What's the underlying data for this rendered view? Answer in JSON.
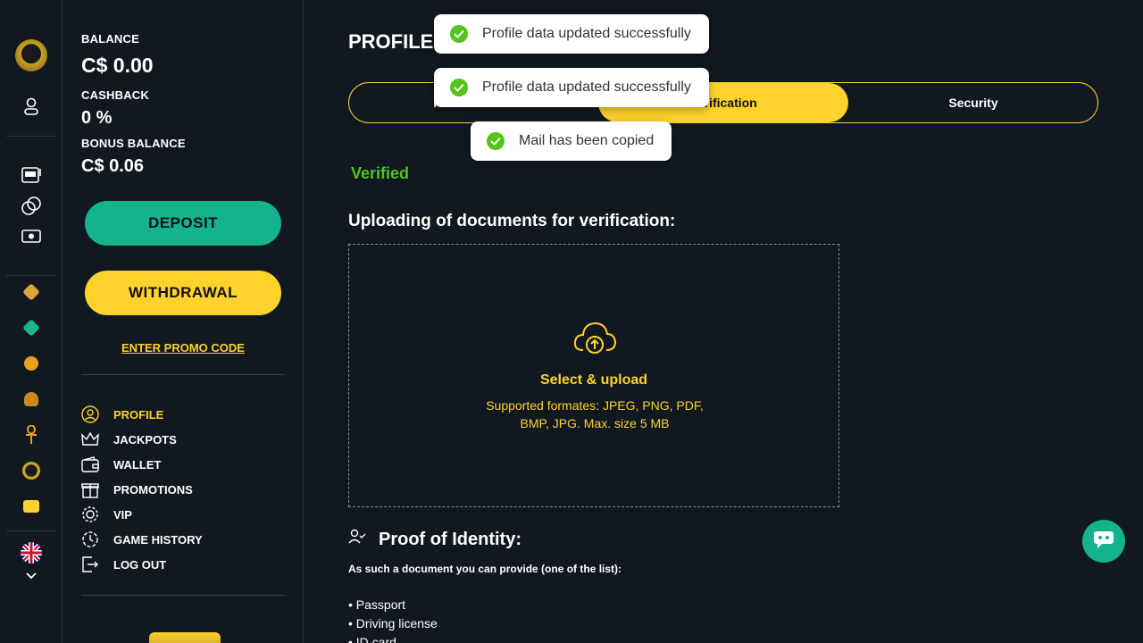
{
  "sidebar": {
    "balance_label": "BALANCE",
    "balance_value": "C$ 0.00",
    "cashback_label": "CASHBACK",
    "cashback_value": "0 %",
    "bonus_label": "BONUS BALANCE",
    "bonus_value": "C$ 0.06",
    "deposit_label": "DEPOSIT",
    "withdrawal_label": "WITHDRAWAL",
    "promo_label": "ENTER PROMO CODE",
    "menu": [
      {
        "label": "PROFILE",
        "icon": "profile-icon"
      },
      {
        "label": "JACKPOTS",
        "icon": "crown-icon"
      },
      {
        "label": "WALLET",
        "icon": "wallet-icon"
      },
      {
        "label": "PROMOTIONS",
        "icon": "gift-icon"
      },
      {
        "label": "VIP",
        "icon": "vip-icon"
      },
      {
        "label": "GAME HISTORY",
        "icon": "history-icon"
      },
      {
        "label": "LOG OUT",
        "icon": "logout-icon"
      }
    ]
  },
  "main": {
    "title": "PROFILE",
    "tabs": [
      {
        "label": "Personal data"
      },
      {
        "label": "Verification"
      },
      {
        "label": "Security"
      }
    ],
    "status": "Verified",
    "upload_heading": "Uploading of documents for verification:",
    "upload_title": "Select & upload",
    "upload_formats": "Supported formates: JPEG, PNG, PDF, BMP, JPG. Max. size 5 MB",
    "proof_title": "Proof of Identity:",
    "proof_desc": "As such a document you can provide (one of the list):",
    "documents": [
      "• Passport",
      "• Driving license",
      "• ID card"
    ]
  },
  "toasts": [
    "Profile data updated successfully",
    "Profile data updated successfully",
    "Mail has been copied"
  ],
  "colors": {
    "accent": "#fdd22b",
    "deposit": "#12b38d",
    "success": "#52c41a",
    "background": "#111820"
  }
}
